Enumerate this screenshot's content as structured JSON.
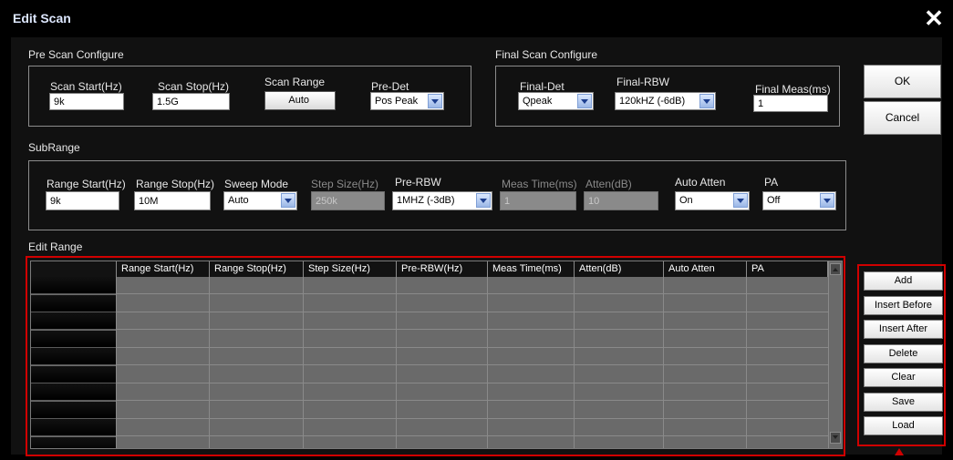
{
  "window": {
    "title": "Edit Scan",
    "close_glyph": "✕"
  },
  "pre_scan": {
    "label": "Pre Scan Configure",
    "scan_start": {
      "label": "Scan Start(Hz)",
      "value": "9k"
    },
    "scan_stop": {
      "label": "Scan Stop(Hz)",
      "value": "1.5G"
    },
    "scan_range": {
      "label": "Scan Range",
      "button": "Auto"
    },
    "pre_det": {
      "label": "Pre-Det",
      "value": "Pos Peak"
    }
  },
  "final_scan": {
    "label": "Final Scan Configure",
    "final_det": {
      "label": "Final-Det",
      "value": "Qpeak"
    },
    "final_rbw": {
      "label": "Final-RBW",
      "value": "120kHZ (-6dB)"
    },
    "final_meas": {
      "label": "Final Meas(ms)",
      "value": "1"
    }
  },
  "actions": {
    "ok": "OK",
    "cancel": "Cancel"
  },
  "subrange": {
    "label": "SubRange",
    "range_start": {
      "label": "Range Start(Hz)",
      "value": "9k"
    },
    "range_stop": {
      "label": "Range Stop(Hz)",
      "value": "10M"
    },
    "sweep_mode": {
      "label": "Sweep Mode",
      "value": "Auto"
    },
    "step_size": {
      "label": "Step Size(Hz)",
      "value": "250k"
    },
    "pre_rbw": {
      "label": "Pre-RBW",
      "value": "1MHZ (-3dB)"
    },
    "meas_time": {
      "label": "Meas Time(ms)",
      "value": "1"
    },
    "atten": {
      "label": "Atten(dB)",
      "value": "10"
    },
    "auto_atten": {
      "label": "Auto Atten",
      "value": "On"
    },
    "pa": {
      "label": "PA",
      "value": "Off"
    }
  },
  "edit_range": {
    "label": "Edit Range",
    "columns": [
      "Range Start(Hz)",
      "Range Stop(Hz)",
      "Step Size(Hz)",
      "Pre-RBW(Hz)",
      "Meas Time(ms)",
      "Atten(dB)",
      "Auto Atten",
      "PA"
    ],
    "row_count": 10,
    "buttons": [
      "Add",
      "Insert Before",
      "Insert After",
      "Delete",
      "Clear",
      "Save",
      "Load"
    ]
  },
  "colors": {
    "highlight": "#d00000",
    "title": "#dde7ff",
    "background": "#111111"
  }
}
